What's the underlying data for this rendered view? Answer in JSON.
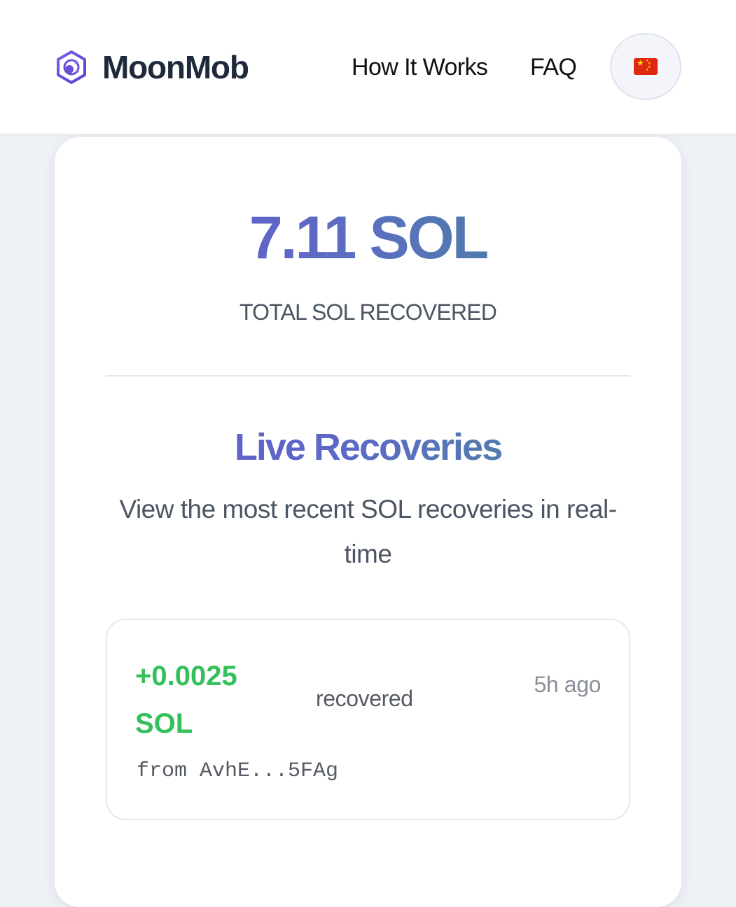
{
  "header": {
    "brand_name": "MoonMob",
    "nav": [
      "How It Works",
      "FAQ"
    ],
    "language_icon": "china-flag-icon"
  },
  "stats": {
    "total_amount": "7.11 SOL",
    "total_label": "TOTAL SOL RECOVERED"
  },
  "live": {
    "title": "Live Recoveries",
    "subtitle": "View the most recent SOL recoveries in real-time",
    "items": [
      {
        "amount": "+0.0025 SOL",
        "verb": "recovered",
        "time": "5h ago",
        "from": "from AvhE...5FAg"
      }
    ]
  },
  "colors": {
    "accent_purple": "#6a4fd6",
    "accent_teal": "#3e9488",
    "success_green": "#34c05a"
  }
}
